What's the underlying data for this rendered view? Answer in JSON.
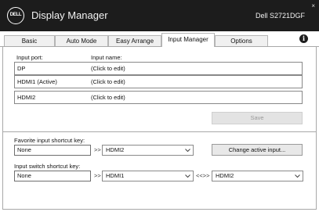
{
  "window": {
    "logo_text": "DELL",
    "app_title": "Display Manager",
    "monitor_name": "Dell S2721DGF",
    "close_glyph": "×"
  },
  "tabs": [
    {
      "label": "Basic"
    },
    {
      "label": "Auto Mode"
    },
    {
      "label": "Easy Arrange"
    },
    {
      "label": "Input Manager",
      "active": true
    },
    {
      "label": "Options"
    }
  ],
  "info_glyph": "i",
  "input_table": {
    "port_header": "Input port:",
    "name_header": "Input name:",
    "rows": [
      {
        "port": "DP",
        "name": "(Click to edit)"
      },
      {
        "port": "HDMI1 (Active)",
        "name": "(Click to edit)"
      },
      {
        "port": "HDMI2",
        "name": "(Click to edit)"
      }
    ]
  },
  "save_label": "Save",
  "favorite": {
    "label": "Favorite input shortcut key:",
    "key_value": "None",
    "arrow": ">>",
    "selected_input": "HDMI2",
    "change_button": "Change active input..."
  },
  "switch": {
    "label": "Input switch shortcut key:",
    "key_value": "None",
    "arrow": ">>",
    "input_a": "HDMI1",
    "swap_arrow": "<<>>",
    "input_b": "HDMI2"
  },
  "colors": {
    "titlebar": "#1c1c1c",
    "border": "#a8a8a8",
    "disabled_button": "#e3e3e3"
  }
}
